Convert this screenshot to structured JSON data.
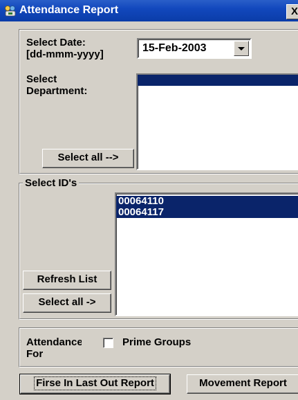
{
  "window": {
    "title": "Attendance Report",
    "close_glyph": "X"
  },
  "date": {
    "label_line1": "Select Date:",
    "label_line2": "[dd-mmm-yyyy]",
    "value": "15-Feb-2003"
  },
  "department": {
    "label_line1": "Select",
    "label_line2": "Department:",
    "items": [
      ""
    ],
    "select_all_label": "Select all -->"
  },
  "ids": {
    "legend": "Select ID's",
    "items": [
      "00064110",
      "00064117"
    ],
    "refresh_label": "Refresh List",
    "select_all_label": "Select all ->"
  },
  "attendance_for": {
    "label_line1": "Attendance",
    "label_line2": "For",
    "checkbox_label": "Prime Groups",
    "checked": false
  },
  "footer": {
    "first_last_label": "Firse In Last Out Report",
    "movement_label": "Movement Report"
  },
  "colors": {
    "title_bar": "#1248bd",
    "selection": "#0a246a",
    "face": "#d4d0c8"
  }
}
